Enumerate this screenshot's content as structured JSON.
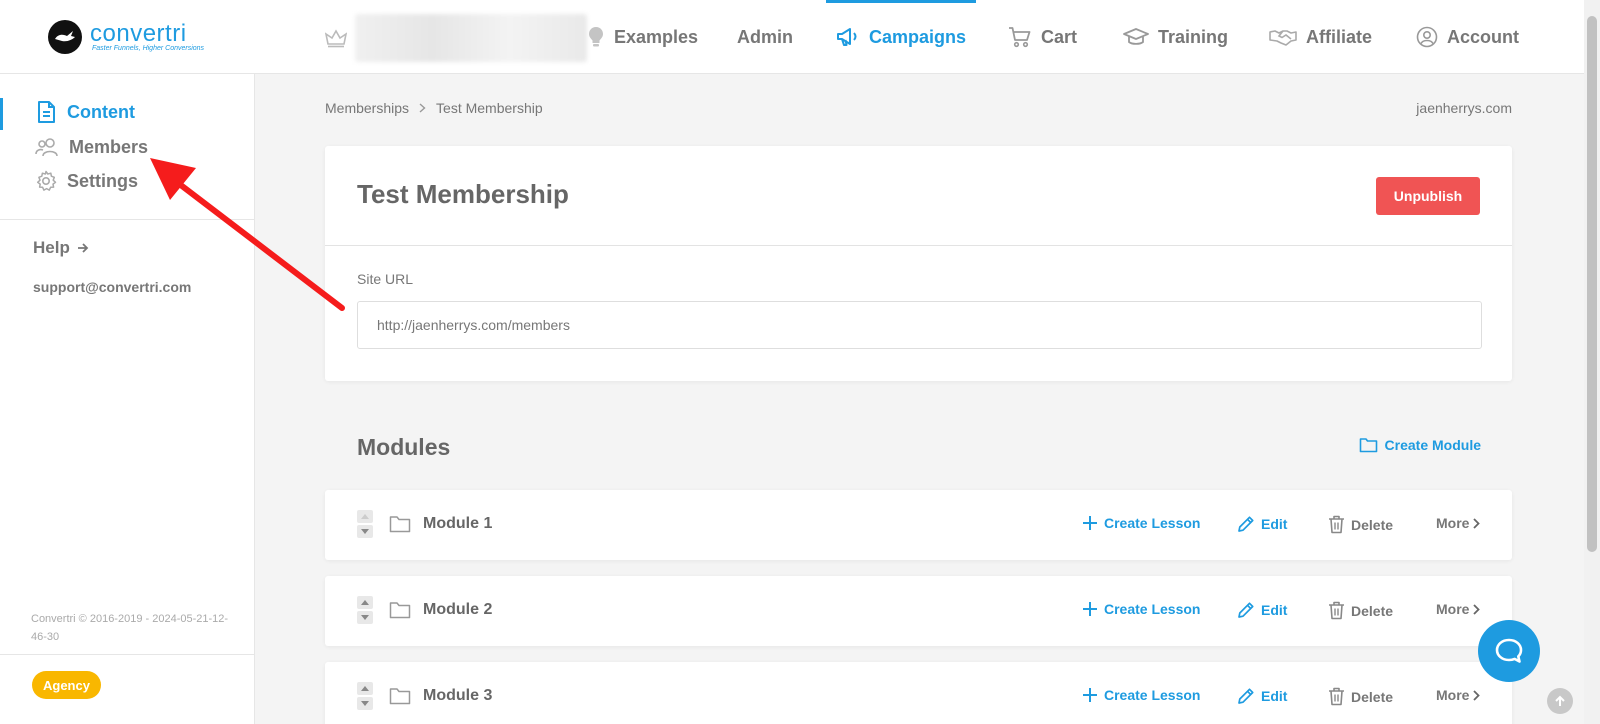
{
  "brand": {
    "name": "convertri",
    "tagline": "Faster Funnels, Higher Conversions"
  },
  "nav": {
    "items": [
      {
        "label": "Examples"
      },
      {
        "label": "Admin"
      },
      {
        "label": "Campaigns"
      },
      {
        "label": "Cart"
      },
      {
        "label": "Training"
      },
      {
        "label": "Affiliate"
      },
      {
        "label": "Account"
      }
    ],
    "active": "Campaigns"
  },
  "sidebar": {
    "items": [
      {
        "label": "Content",
        "icon": "document-icon"
      },
      {
        "label": "Members",
        "icon": "users-icon"
      },
      {
        "label": "Settings",
        "icon": "gear-icon"
      }
    ],
    "help_label": "Help",
    "support_email": "support@convertri.com",
    "copyright": "Convertri © 2016-2019 - 2024-05-21-12-46-30",
    "plan_badge": "Agency"
  },
  "breadcrumb": {
    "parent": "Memberships",
    "current": "Test Membership"
  },
  "domain": "jaenherrys.com",
  "membership": {
    "title": "Test Membership",
    "unpublish_label": "Unpublish",
    "site_url_label": "Site URL",
    "site_url_value": "http://jaenherrys.com/members"
  },
  "modules": {
    "title": "Modules",
    "create_label": "Create Module",
    "actions": {
      "create_lesson": "Create Lesson",
      "edit": "Edit",
      "delete": "Delete",
      "more": "More"
    },
    "items": [
      {
        "name": "Module 1"
      },
      {
        "name": "Module 2"
      },
      {
        "name": "Module 3"
      }
    ]
  },
  "colors": {
    "accent": "#1e9be0",
    "danger": "#f05454",
    "badge": "#f9b700",
    "annotation": "#f51c1c"
  }
}
